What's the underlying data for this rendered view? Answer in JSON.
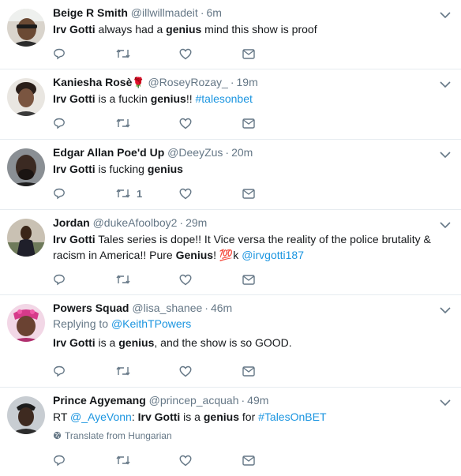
{
  "tweets": [
    {
      "name": "Beige R Smith",
      "emoji": "",
      "handle": "@illwillmadeit",
      "time": "6m",
      "reply_label": "",
      "reply_handle": "",
      "segments": [
        {
          "t": "Irv Gotti",
          "style": "bold"
        },
        {
          "t": " always had a ",
          "style": "plain"
        },
        {
          "t": "genius",
          "style": "bold"
        },
        {
          "t": " mind this show is proof",
          "style": "plain"
        }
      ],
      "retweet_count": "",
      "translate": ""
    },
    {
      "name": "Kaniesha Rosè",
      "emoji": "🌹",
      "handle": "@RoseyRozay_",
      "time": "19m",
      "reply_label": "",
      "reply_handle": "",
      "segments": [
        {
          "t": "Irv Gotti",
          "style": "bold"
        },
        {
          "t": " is a fuckin ",
          "style": "plain"
        },
        {
          "t": "genius",
          "style": "bold"
        },
        {
          "t": "!!  ",
          "style": "plain"
        },
        {
          "t": "#talesonbet",
          "style": "link"
        }
      ],
      "retweet_count": "",
      "translate": ""
    },
    {
      "name": "Edgar Allan Poe'd Up",
      "emoji": "",
      "handle": "@DeeyZus",
      "time": "20m",
      "reply_label": "",
      "reply_handle": "",
      "segments": [
        {
          "t": "Irv Gotti",
          "style": "bold"
        },
        {
          "t": " is fucking ",
          "style": "plain"
        },
        {
          "t": "genius",
          "style": "bold"
        }
      ],
      "retweet_count": "1",
      "translate": ""
    },
    {
      "name": "Jordan",
      "emoji": "",
      "handle": "@dukeAfoolboy2",
      "time": "29m",
      "reply_label": "",
      "reply_handle": "",
      "segments": [
        {
          "t": "Irv Gotti",
          "style": "bold"
        },
        {
          "t": " Tales series is dope!! It Vice versa the reality of the police brutality & racism in America!! Pure ",
          "style": "plain"
        },
        {
          "t": "Genius",
          "style": "bold"
        },
        {
          "t": "! ",
          "style": "plain"
        },
        {
          "t": "💯",
          "style": "emoji"
        },
        {
          "t": "k ",
          "style": "plain"
        },
        {
          "t": "@irvgotti187",
          "style": "link"
        }
      ],
      "retweet_count": "",
      "translate": ""
    },
    {
      "name": "Powers Squad",
      "emoji": "",
      "handle": "@lisa_shanee",
      "time": "46m",
      "reply_label": "Replying to ",
      "reply_handle": "@KeithTPowers",
      "segments": [
        {
          "t": "Irv Gotti",
          "style": "bold"
        },
        {
          "t": " is a ",
          "style": "plain"
        },
        {
          "t": "genius",
          "style": "bold"
        },
        {
          "t": ", and the show is so GOOD.",
          "style": "plain"
        }
      ],
      "retweet_count": "",
      "translate": ""
    },
    {
      "name": "Prince Agyemang",
      "emoji": "",
      "handle": "@princep_acquah",
      "time": "49m",
      "reply_label": "",
      "reply_handle": "",
      "segments": [
        {
          "t": "RT ",
          "style": "plain"
        },
        {
          "t": "@_AyeVonn",
          "style": "link"
        },
        {
          "t": ": ",
          "style": "plain"
        },
        {
          "t": "Irv Gotti",
          "style": "bold"
        },
        {
          "t": " is a ",
          "style": "plain"
        },
        {
          "t": "genius",
          "style": "bold"
        },
        {
          "t": " for ",
          "style": "plain"
        },
        {
          "t": "#TalesOnBET",
          "style": "link"
        }
      ],
      "retweet_count": "",
      "translate": "Translate from Hungarian"
    }
  ],
  "icons": {
    "reply": "reply-icon",
    "retweet": "retweet-icon",
    "like": "heart-icon",
    "dm": "envelope-icon",
    "caret": "chevron-down-icon",
    "globe": "globe-icon"
  },
  "colors": {
    "link": "#1b95e0",
    "muted": "#657786",
    "text": "#14171a",
    "divider": "#e6ecf0"
  }
}
